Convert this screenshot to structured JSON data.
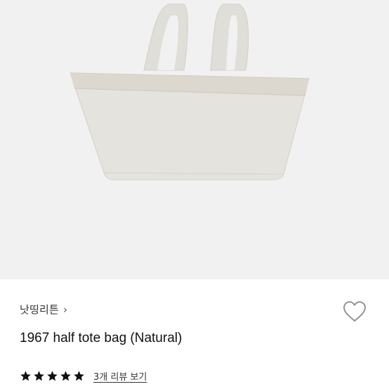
{
  "product": {
    "image_alt": "1967 half tote bag (Natural)",
    "brand": "낫띵리튼",
    "brand_chevron": "›",
    "title": "1967 half tote bag (Natural)",
    "rating": {
      "stars": 5,
      "max_stars": 5,
      "reviews_link": "3개 리뷰 보기"
    }
  },
  "icons": {
    "wishlist": "heart-outline-icon",
    "brand_arrow": "chevron-right-icon",
    "rating_star": "star-filled-icon"
  },
  "colors": {
    "hero_bg": "#f1f1f1",
    "bag_body": "#e5e3dd",
    "bag_trim": "#ddd9d1",
    "star": "#111111"
  }
}
